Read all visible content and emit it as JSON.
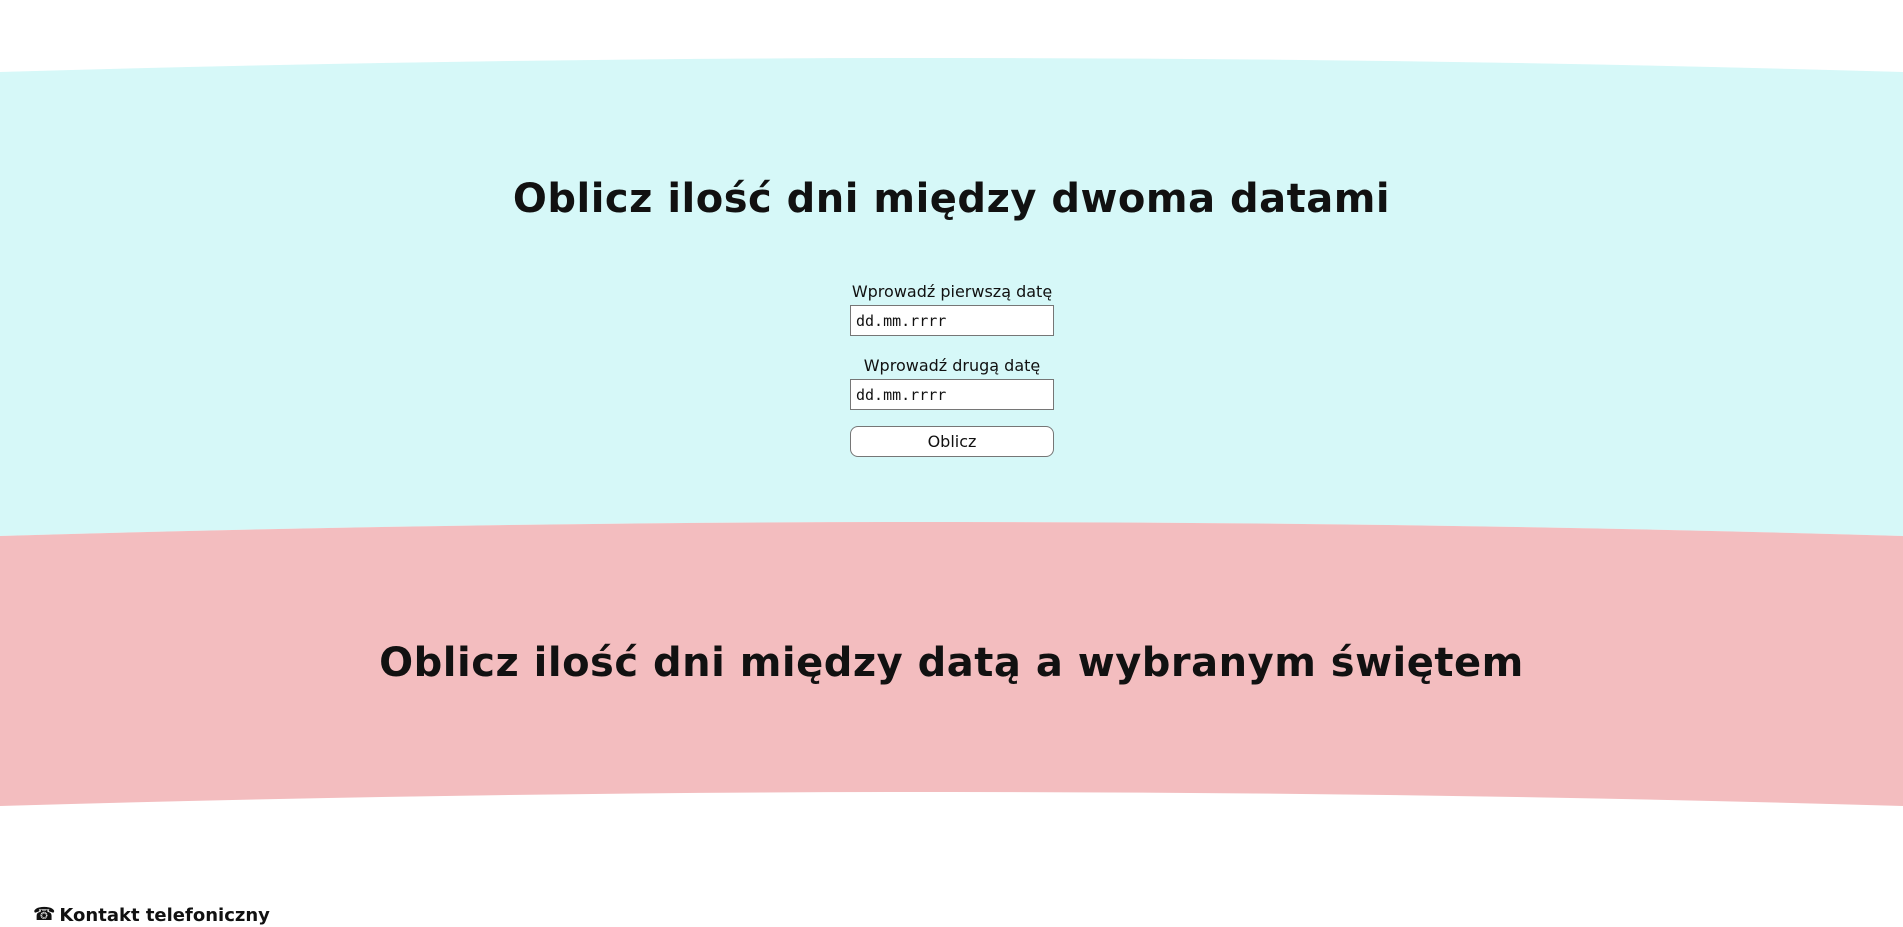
{
  "colors": {
    "section1_background": "#d6f8f8",
    "section2_background": "#f3bdbf",
    "page_background": "#ffffff"
  },
  "section1": {
    "title": "Oblicz ilość dni między dwoma datami",
    "first_date_label": "Wprowadź pierwszą datę",
    "first_date_placeholder": "dd.mm.rrrr",
    "second_date_label": "Wprowadź drugą datę",
    "second_date_placeholder": "dd.mm.rrrr",
    "calculate_button": "Oblicz"
  },
  "section2": {
    "title": "Oblicz ilość dni między datą a wybranym świętem"
  },
  "footer": {
    "contact_icon": "telephone-icon",
    "contact_label": "Kontakt telefoniczny"
  }
}
